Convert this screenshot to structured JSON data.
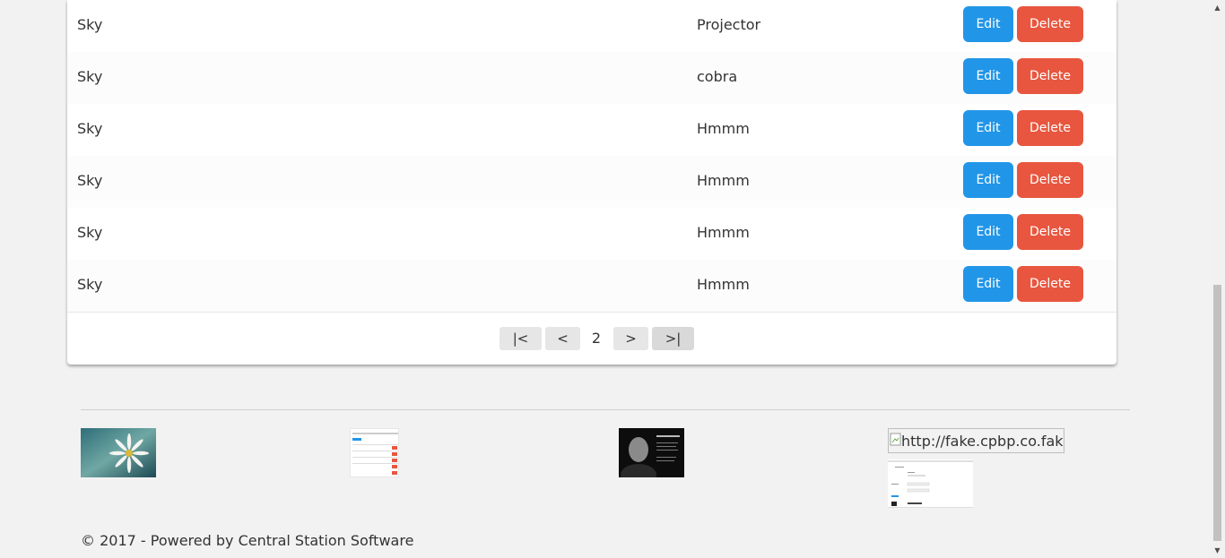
{
  "table": {
    "rows": [
      {
        "name": "Sky",
        "item": "Projector",
        "edit": "Edit",
        "delete": "Delete"
      },
      {
        "name": "Sky",
        "item": "cobra",
        "edit": "Edit",
        "delete": "Delete"
      },
      {
        "name": "Sky",
        "item": "Hmmm",
        "edit": "Edit",
        "delete": "Delete"
      },
      {
        "name": "Sky",
        "item": "Hmmm",
        "edit": "Edit",
        "delete": "Delete"
      },
      {
        "name": "Sky",
        "item": "Hmmm",
        "edit": "Edit",
        "delete": "Delete"
      },
      {
        "name": "Sky",
        "item": "Hmmm",
        "edit": "Edit",
        "delete": "Delete"
      }
    ]
  },
  "pagination": {
    "first": "|<",
    "prev": "<",
    "current": "2",
    "next": ">",
    "last": ">|"
  },
  "footer": {
    "broken_image_alt": "http://fake.cpbp.co.fake",
    "copyright": "© 2017 - Powered by Central Station Software"
  },
  "colors": {
    "edit": "#2196e8",
    "delete": "#e8563f"
  }
}
